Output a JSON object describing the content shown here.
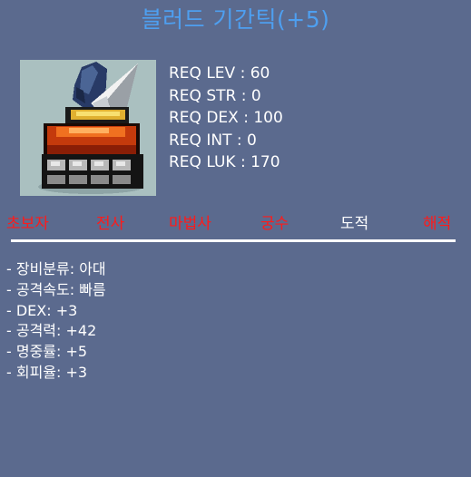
{
  "item": {
    "name": "블러드 기간틱(+5)",
    "icon": "blood-gigantic-knuckle-icon"
  },
  "requirements": [
    "REQ LEV : 60",
    "REQ STR : 0",
    "REQ DEX : 100",
    "REQ INT : 0",
    "REQ LUK : 170"
  ],
  "jobs": [
    {
      "label": "초보자",
      "active": false
    },
    {
      "label": "전사",
      "active": false
    },
    {
      "label": "마법사",
      "active": false
    },
    {
      "label": "궁수",
      "active": false
    },
    {
      "label": "도적",
      "active": true
    },
    {
      "label": "해적",
      "active": false
    }
  ],
  "stats": [
    "- 장비분류: 아대",
    "- 공격속도: 빠름",
    "- DEX: +3",
    "- 공격력: +42",
    "- 명중률: +5",
    "- 회피율: +3"
  ],
  "colors": {
    "background": "#5b6a8e",
    "title": "#4e9ff0",
    "job_unavailable": "#ff1a1a",
    "job_available": "#ffffff"
  }
}
